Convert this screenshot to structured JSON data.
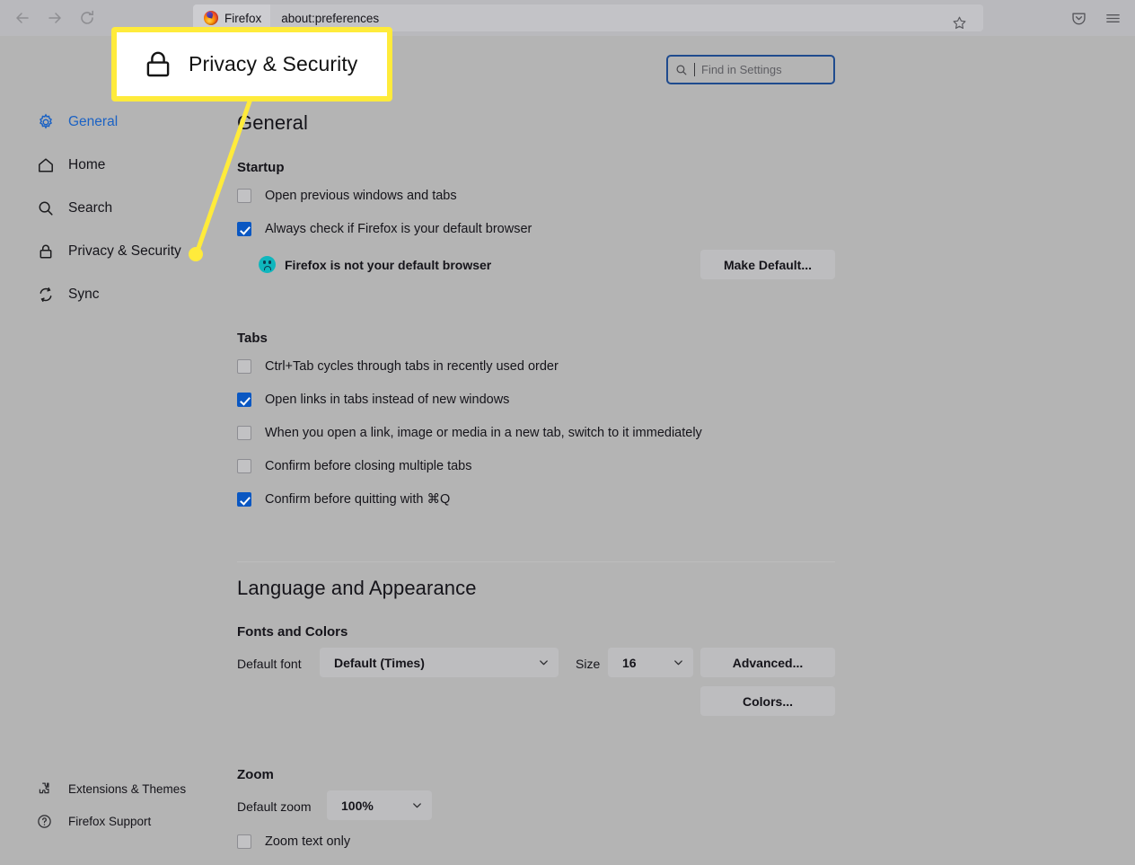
{
  "browser": {
    "back_icon": "back-arrow-icon",
    "forward_icon": "forward-arrow-icon",
    "reload_icon": "reload-icon",
    "brand_label": "Firefox",
    "url": "about:preferences",
    "bookmark_icon": "star-icon",
    "pocket_icon": "pocket-icon",
    "menu_icon": "hamburger-menu-icon"
  },
  "search": {
    "placeholder": "Find in Settings",
    "value": "",
    "icon": "search-icon"
  },
  "sidebar": {
    "items": [
      {
        "label": "General",
        "icon": "gear-icon",
        "active": true
      },
      {
        "label": "Home",
        "icon": "home-icon",
        "active": false
      },
      {
        "label": "Search",
        "icon": "search-icon",
        "active": false
      },
      {
        "label": "Privacy & Security",
        "icon": "lock-icon",
        "active": false
      },
      {
        "label": "Sync",
        "icon": "sync-icon",
        "active": false
      }
    ],
    "footer": [
      {
        "label": "Extensions & Themes",
        "icon": "puzzle-piece-icon"
      },
      {
        "label": "Firefox Support",
        "icon": "question-circle-icon"
      }
    ]
  },
  "main": {
    "page_title": "General",
    "startup": {
      "heading": "Startup",
      "checkboxes": [
        {
          "label": "Open previous windows and tabs",
          "checked": false
        },
        {
          "label": "Always check if Firefox is your default browser",
          "checked": true
        }
      ],
      "default_status": "Firefox is not your default browser",
      "default_status_icon": "firefox-sad-face-icon",
      "make_default_label": "Make Default..."
    },
    "tabs": {
      "heading": "Tabs",
      "checkboxes": [
        {
          "label": "Ctrl+Tab cycles through tabs in recently used order",
          "checked": false
        },
        {
          "label": "Open links in tabs instead of new windows",
          "checked": true
        },
        {
          "label": "When you open a link, image or media in a new tab, switch to it immediately",
          "checked": false
        },
        {
          "label": "Confirm before closing multiple tabs",
          "checked": false
        },
        {
          "label": "Confirm before quitting with ⌘Q",
          "checked": true
        }
      ]
    },
    "language_appearance": {
      "heading": "Language and Appearance",
      "fonts_heading": "Fonts and Colors",
      "default_font_label": "Default font",
      "default_font_value": "Default (Times)",
      "size_label": "Size",
      "size_value": "16",
      "advanced_label": "Advanced...",
      "colors_label": "Colors..."
    },
    "zoom": {
      "heading": "Zoom",
      "default_zoom_label": "Default zoom",
      "default_zoom_value": "100%",
      "zoom_text_only_label": "Zoom text only",
      "zoom_text_only_checked": false
    }
  },
  "callout": {
    "text": "Privacy & Security",
    "icon": "lock-icon",
    "border_color": "#ffeb3b",
    "pointer_color": "#ffeb3b"
  },
  "colors": {
    "page_background": "#b4b4b4",
    "chrome_background": "#b9b9bd",
    "accent_blue": "#1b62c4",
    "checkbox_checked": "#0a57c2",
    "button_background": "#bdbdbf",
    "search_border": "#1f4b8e",
    "status_icon": "#0fb6bd"
  }
}
